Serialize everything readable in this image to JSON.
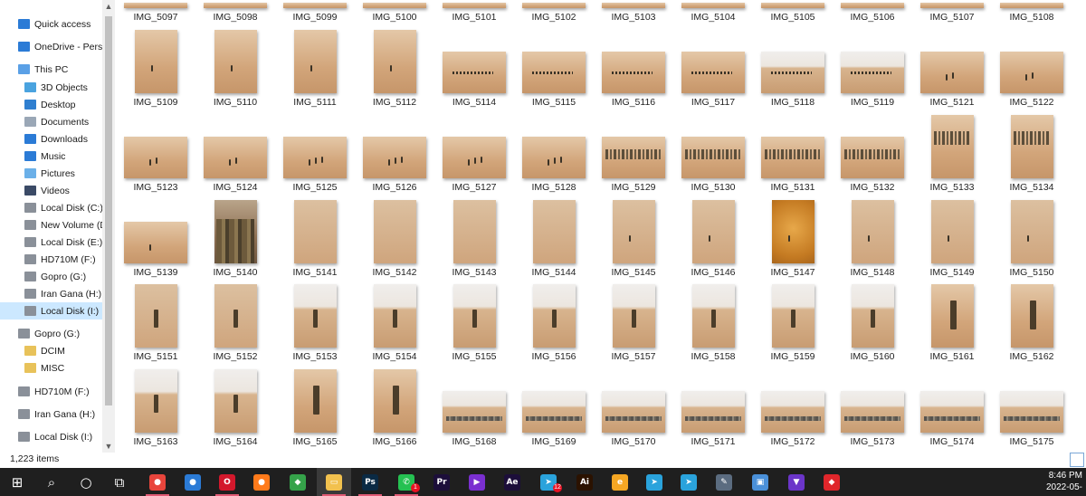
{
  "navigation": {
    "items": [
      {
        "label": "Quick access",
        "icon": "star-icon",
        "color": "#2b7bd6",
        "indent": 1,
        "selected": false
      },
      {
        "label": "OneDrive - Personal",
        "icon": "onedrive-cloud-icon",
        "color": "#2b7bd6",
        "indent": 1,
        "selected": false
      },
      {
        "label": "This PC",
        "icon": "computer-icon",
        "color": "#5aa0e6",
        "indent": 1,
        "selected": false
      },
      {
        "label": "3D Objects",
        "icon": "3d-objects-icon",
        "color": "#4aa3df",
        "indent": 2,
        "selected": false
      },
      {
        "label": "Desktop",
        "icon": "desktop-icon",
        "color": "#2f7fd0",
        "indent": 2,
        "selected": false
      },
      {
        "label": "Documents",
        "icon": "documents-icon",
        "color": "#9aa7b6",
        "indent": 2,
        "selected": false
      },
      {
        "label": "Downloads",
        "icon": "download-arrow-icon",
        "color": "#2b7bd6",
        "indent": 2,
        "selected": false
      },
      {
        "label": "Music",
        "icon": "music-note-icon",
        "color": "#2b7bd6",
        "indent": 2,
        "selected": false
      },
      {
        "label": "Pictures",
        "icon": "pictures-icon",
        "color": "#6bb0e8",
        "indent": 2,
        "selected": false
      },
      {
        "label": "Videos",
        "icon": "videos-icon",
        "color": "#3b4a66",
        "indent": 2,
        "selected": false
      },
      {
        "label": "Local Disk (C:)",
        "icon": "windows-drive-icon",
        "color": "#8a9099",
        "indent": 2,
        "selected": false
      },
      {
        "label": "New Volume (D:)",
        "icon": "drive-icon",
        "color": "#8a9099",
        "indent": 2,
        "selected": false
      },
      {
        "label": "Local Disk (E:)",
        "icon": "drive-icon",
        "color": "#8a9099",
        "indent": 2,
        "selected": false
      },
      {
        "label": "HD710M (F:)",
        "icon": "drive-icon",
        "color": "#8a9099",
        "indent": 2,
        "selected": false
      },
      {
        "label": "Gopro (G:)",
        "icon": "drive-icon",
        "color": "#8a9099",
        "indent": 2,
        "selected": false
      },
      {
        "label": "Iran Gana (H:)",
        "icon": "drive-icon",
        "color": "#8a9099",
        "indent": 2,
        "selected": false
      },
      {
        "label": "Local Disk (I:)",
        "icon": "drive-icon",
        "color": "#8a9099",
        "indent": 2,
        "selected": true
      },
      {
        "label": "Gopro (G:)",
        "icon": "drive-icon",
        "color": "#8a9099",
        "indent": 1,
        "selected": false
      },
      {
        "label": "DCIM",
        "icon": "folder-icon",
        "color": "#e8c25a",
        "indent": 2,
        "selected": false
      },
      {
        "label": "MISC",
        "icon": "folder-icon",
        "color": "#e8c25a",
        "indent": 2,
        "selected": false
      },
      {
        "label": "HD710M (F:)",
        "icon": "drive-icon",
        "color": "#8a9099",
        "indent": 1,
        "selected": false
      },
      {
        "label": "Iran Gana (H:)",
        "icon": "drive-icon",
        "color": "#8a9099",
        "indent": 1,
        "selected": false
      },
      {
        "label": "Local Disk (I:)",
        "icon": "drive-icon",
        "color": "#8a9099",
        "indent": 1,
        "selected": false
      }
    ]
  },
  "files": {
    "rows": [
      [
        {
          "name": "IMG_5097",
          "kind": "partial"
        },
        {
          "name": "IMG_5098",
          "kind": "partial"
        },
        {
          "name": "IMG_5099",
          "kind": "partial"
        },
        {
          "name": "IMG_5100",
          "kind": "partial"
        },
        {
          "name": "IMG_5101",
          "kind": "partial"
        },
        {
          "name": "IMG_5102",
          "kind": "partial"
        },
        {
          "name": "IMG_5103",
          "kind": "partial"
        },
        {
          "name": "IMG_5104",
          "kind": "partial"
        },
        {
          "name": "IMG_5105",
          "kind": "partial"
        },
        {
          "name": "IMG_5106",
          "kind": "partial"
        },
        {
          "name": "IMG_5107",
          "kind": "partial"
        },
        {
          "name": "IMG_5108",
          "kind": "partial"
        }
      ],
      [
        {
          "name": "IMG_5109",
          "kind": "portrait-dune"
        },
        {
          "name": "IMG_5110",
          "kind": "portrait-dune"
        },
        {
          "name": "IMG_5111",
          "kind": "portrait-dune"
        },
        {
          "name": "IMG_5112",
          "kind": "portrait-dune"
        },
        {
          "name": "IMG_5114",
          "kind": "landscape-caravan"
        },
        {
          "name": "IMG_5115",
          "kind": "landscape-caravan"
        },
        {
          "name": "IMG_5116",
          "kind": "landscape-caravan"
        },
        {
          "name": "IMG_5117",
          "kind": "landscape-caravan"
        },
        {
          "name": "IMG_5118",
          "kind": "landscape-caravan-pale"
        },
        {
          "name": "IMG_5119",
          "kind": "landscape-caravan-pale"
        },
        {
          "name": "IMG_5121",
          "kind": "landscape-figures"
        },
        {
          "name": "IMG_5122",
          "kind": "landscape-figures"
        }
      ],
      [
        {
          "name": "IMG_5123",
          "kind": "landscape-figures"
        },
        {
          "name": "IMG_5124",
          "kind": "landscape-figures"
        },
        {
          "name": "IMG_5125",
          "kind": "landscape-dune"
        },
        {
          "name": "IMG_5126",
          "kind": "landscape-dune"
        },
        {
          "name": "IMG_5127",
          "kind": "landscape-dune"
        },
        {
          "name": "IMG_5128",
          "kind": "landscape-dune"
        },
        {
          "name": "IMG_5129",
          "kind": "landscape-crowd"
        },
        {
          "name": "IMG_5130",
          "kind": "landscape-crowd"
        },
        {
          "name": "IMG_5131",
          "kind": "landscape-crowd"
        },
        {
          "name": "IMG_5132",
          "kind": "landscape-crowd"
        },
        {
          "name": "IMG_5133",
          "kind": "portrait-crowd"
        },
        {
          "name": "IMG_5134",
          "kind": "portrait-crowd"
        }
      ],
      [
        {
          "name": "IMG_5139",
          "kind": "landscape-figure"
        },
        {
          "name": "IMG_5140",
          "kind": "portrait-people"
        },
        {
          "name": "IMG_5141",
          "kind": "portrait-dust"
        },
        {
          "name": "IMG_5142",
          "kind": "portrait-dust"
        },
        {
          "name": "IMG_5143",
          "kind": "portrait-dust"
        },
        {
          "name": "IMG_5144",
          "kind": "portrait-dust"
        },
        {
          "name": "IMG_5145",
          "kind": "portrait-dust-figure"
        },
        {
          "name": "IMG_5146",
          "kind": "portrait-dust-figure"
        },
        {
          "name": "IMG_5147",
          "kind": "portrait-orange"
        },
        {
          "name": "IMG_5148",
          "kind": "portrait-dust-figure"
        },
        {
          "name": "IMG_5149",
          "kind": "portrait-dust-figure"
        },
        {
          "name": "IMG_5150",
          "kind": "portrait-dust-figure"
        }
      ],
      [
        {
          "name": "IMG_5151",
          "kind": "portrait-soldier-dust"
        },
        {
          "name": "IMG_5152",
          "kind": "portrait-soldier-dust"
        },
        {
          "name": "IMG_5153",
          "kind": "portrait-soldier-sky"
        },
        {
          "name": "IMG_5154",
          "kind": "portrait-soldier-sky"
        },
        {
          "name": "IMG_5155",
          "kind": "portrait-soldier-sky"
        },
        {
          "name": "IMG_5156",
          "kind": "portrait-soldier-sky"
        },
        {
          "name": "IMG_5157",
          "kind": "portrait-soldier-sky"
        },
        {
          "name": "IMG_5158",
          "kind": "portrait-soldier-sky"
        },
        {
          "name": "IMG_5159",
          "kind": "portrait-soldier-sky"
        },
        {
          "name": "IMG_5160",
          "kind": "portrait-soldier-sky"
        },
        {
          "name": "IMG_5161",
          "kind": "portrait-soldier-close"
        },
        {
          "name": "IMG_5162",
          "kind": "portrait-soldier-close"
        }
      ],
      [
        {
          "name": "IMG_5163",
          "kind": "portrait-soldier-sky"
        },
        {
          "name": "IMG_5164",
          "kind": "portrait-soldier-sky"
        },
        {
          "name": "IMG_5165",
          "kind": "portrait-soldier-close"
        },
        {
          "name": "IMG_5166",
          "kind": "portrait-soldier-close"
        },
        {
          "name": "IMG_5168",
          "kind": "landscape-wreck"
        },
        {
          "name": "IMG_5169",
          "kind": "landscape-wreck"
        },
        {
          "name": "IMG_5170",
          "kind": "landscape-wreck"
        },
        {
          "name": "IMG_5171",
          "kind": "landscape-wreck"
        },
        {
          "name": "IMG_5172",
          "kind": "landscape-wreck"
        },
        {
          "name": "IMG_5173",
          "kind": "landscape-wreck"
        },
        {
          "name": "IMG_5174",
          "kind": "landscape-wreck"
        },
        {
          "name": "IMG_5175",
          "kind": "landscape-wreck"
        }
      ]
    ]
  },
  "status": {
    "item_count": "1,223 items"
  },
  "taskbar": {
    "apps": [
      {
        "icon": "windows-start-icon",
        "glyph": "⊞",
        "bg": "transparent",
        "running": false
      },
      {
        "icon": "search-icon",
        "glyph": "⌕",
        "bg": "transparent",
        "running": false
      },
      {
        "icon": "cortana-circle-icon",
        "glyph": "○",
        "bg": "transparent",
        "running": false
      },
      {
        "icon": "task-view-icon",
        "glyph": "⧉",
        "bg": "transparent",
        "running": false
      },
      {
        "icon": "chrome-icon",
        "glyph": "●",
        "bg": "#e8453c",
        "running": true
      },
      {
        "icon": "chrome-alt-icon",
        "glyph": "●",
        "bg": "#2b7bd6",
        "running": false
      },
      {
        "icon": "opera-icon",
        "glyph": "O",
        "bg": "#d3182c",
        "running": true
      },
      {
        "icon": "firefox-icon",
        "glyph": "●",
        "bg": "#ff7a1a",
        "running": false
      },
      {
        "icon": "network-globe-icon",
        "glyph": "◆",
        "bg": "#35a34a",
        "running": false
      },
      {
        "icon": "file-explorer-icon",
        "glyph": "▭",
        "bg": "#f2c14e",
        "running": true,
        "active": true
      },
      {
        "icon": "photoshop-icon",
        "glyph": "Ps",
        "bg": "#0a2a44",
        "running": true
      },
      {
        "icon": "whatsapp-icon",
        "glyph": "✆",
        "bg": "#25c152",
        "running": true,
        "badge": "1"
      },
      {
        "icon": "premiere-icon",
        "glyph": "Pr",
        "bg": "#1c0e3a",
        "running": false
      },
      {
        "icon": "media-player-icon",
        "glyph": "▶",
        "bg": "#7a2fd0",
        "running": false
      },
      {
        "icon": "after-effects-icon",
        "glyph": "Ae",
        "bg": "#1c0e3a",
        "running": false
      },
      {
        "icon": "telegram-icon",
        "glyph": "➤",
        "bg": "#2aa3dc",
        "running": false,
        "badge": "12"
      },
      {
        "icon": "illustrator-icon",
        "glyph": "Ai",
        "bg": "#2b1200",
        "running": false
      },
      {
        "icon": "browser-orange-icon",
        "glyph": "e",
        "bg": "#f5a623",
        "running": false
      },
      {
        "icon": "telegram-alt-icon",
        "glyph": "➤",
        "bg": "#2aa3dc",
        "running": false
      },
      {
        "icon": "telegram-desktop-icon",
        "glyph": "➤",
        "bg": "#2aa3dc",
        "running": false
      },
      {
        "icon": "tools-icon",
        "glyph": "✎",
        "bg": "#5b6c80",
        "running": false
      },
      {
        "icon": "remote-desktop-icon",
        "glyph": "▣",
        "bg": "#4a90d9",
        "running": false
      },
      {
        "icon": "shield-vpn-icon",
        "glyph": "▼",
        "bg": "#6b35c9",
        "running": false
      },
      {
        "icon": "brave-icon",
        "glyph": "◆",
        "bg": "#e0262b",
        "running": false
      }
    ],
    "time": "8:46 PM",
    "date": "2022-05-"
  },
  "colors": {
    "selection": "#cce8ff",
    "taskbar": "#1f1f1f",
    "sand": "#d9b48f"
  }
}
